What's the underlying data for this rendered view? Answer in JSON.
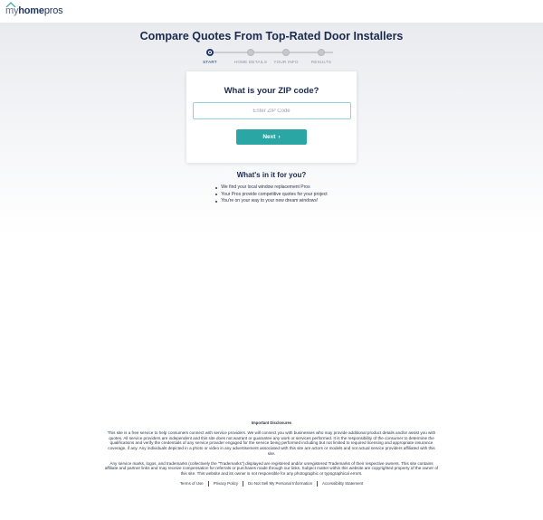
{
  "header": {
    "logo_my": "my",
    "logo_home": "home",
    "logo_pros": "pros"
  },
  "page": {
    "title": "Compare Quotes From Top-Rated Door Installers"
  },
  "progress": {
    "steps": [
      {
        "label": "START",
        "active": true
      },
      {
        "label": "HOME DETAILS",
        "active": false
      },
      {
        "label": "YOUR INFO",
        "active": false
      },
      {
        "label": "RESULTS",
        "active": false
      }
    ],
    "current_step": 1,
    "total_steps": 4
  },
  "form": {
    "question": "What is your ZIP code?",
    "zip_placeholder": "Enter ZIP Code",
    "zip_value": "",
    "next_label": "Next",
    "next_icon": "chevron-right-icon"
  },
  "benefits": {
    "title": "What's in it for you?",
    "items": [
      "We find your local window replacement Pros",
      "Your Pros provide competitive quotes for your project",
      "You're on your way to your new dream windows!"
    ]
  },
  "footer": {
    "disclosures_title": "Important Disclosures",
    "paragraph_1": "This site is a free service to help consumers connect with service providers. We will connect you with businesses who may provide additional product details and/or assist you with quotes. All service providers are independent and this site does not warrant or guarantee any work or services performed. It is the responsibility of the consumer to determine the qualifications and verify the credentials of any service provider engaged for the service being performed including but not limited to required licensing and appropriate insurance coverage, if any. Any individuals depicted in a photo or video in any advertisement associated with this site are actors or models and not actual service providers affiliated with this site.",
    "paragraph_2": "Any service marks, logos, and trademarks (collectively the \"Trademarks\") displayed are registered and/or unregistered Trademarks of their respective owners. This site contains affiliate and partner links and may receive compensation for referrals or purchases made through our links. Subject matter within this website are copyrighted property of the owner of this site. This website and its owner is not responsible for any photographic or typographical errors.",
    "links": [
      "Terms of Use",
      "Privacy Policy",
      "Do Not Sell My Personal Information",
      "Accessibility Statement"
    ]
  },
  "colors": {
    "brand_navy": "#1b2a4e",
    "accent_teal": "#2aa6a4",
    "input_border": "#8fd3de"
  }
}
